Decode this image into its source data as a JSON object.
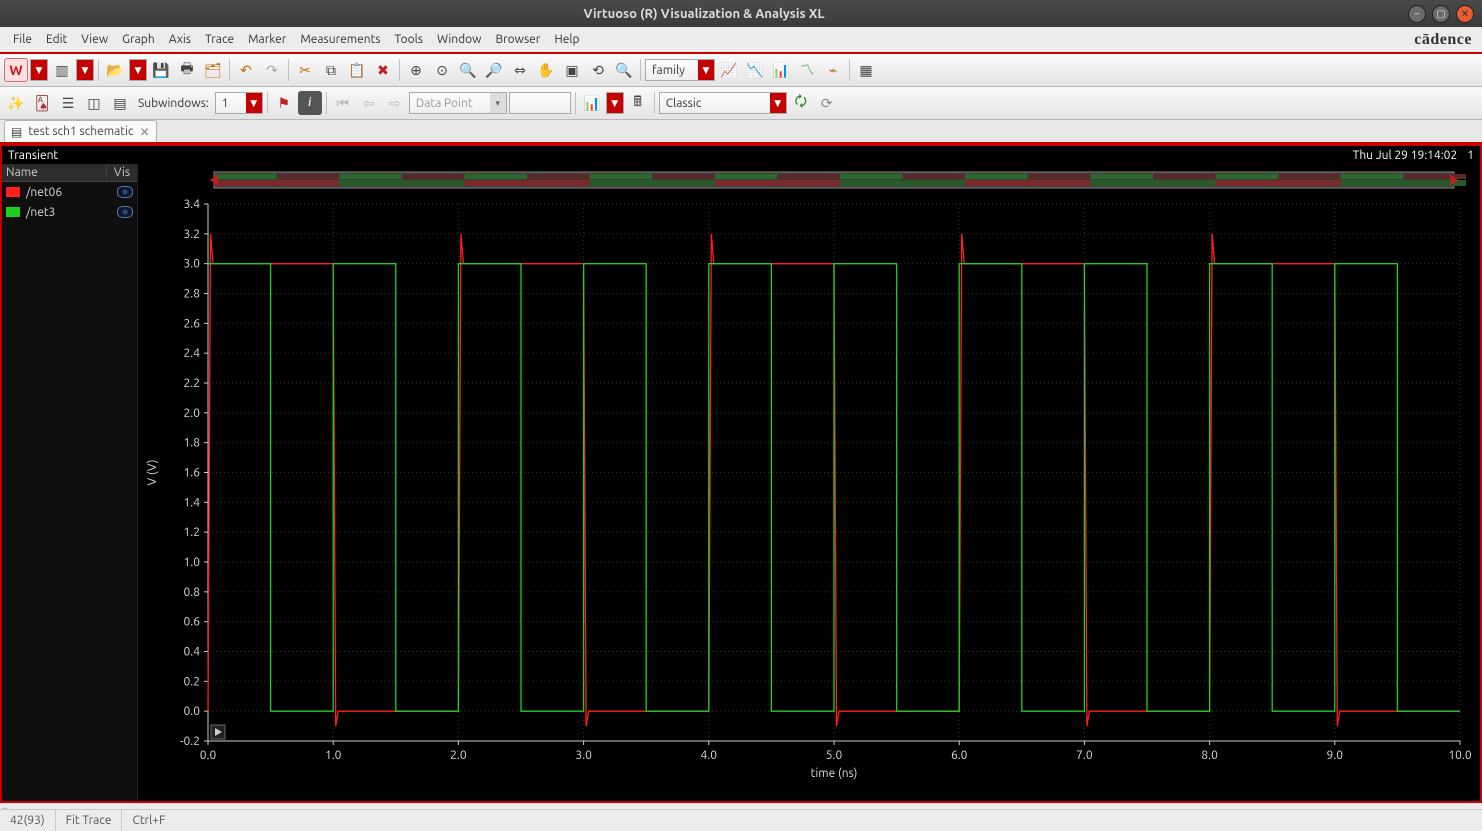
{
  "window": {
    "title": "Virtuoso (R) Visualization & Analysis XL"
  },
  "menu": [
    "File",
    "Edit",
    "View",
    "Graph",
    "Axis",
    "Trace",
    "Marker",
    "Measurements",
    "Tools",
    "Window",
    "Browser",
    "Help"
  ],
  "brand": "cādence",
  "toolbar1": {
    "combo_family": "family"
  },
  "toolbar2": {
    "subwindows_label": "Subwindows:",
    "subwindows_value": "1",
    "datapoint_label": "Data Point",
    "classic_label": "Classic"
  },
  "tab": {
    "label": "test sch1 schematic"
  },
  "plot": {
    "header": "Transient",
    "timestamp": "Thu Jul 29 19:14:02",
    "index": "1",
    "legend_cols": {
      "name": "Name",
      "vis": "Vis"
    },
    "xlabel": "time (ns)",
    "ylabel": "V (V)"
  },
  "legend": [
    {
      "name": "/net06",
      "color": "#ff2020"
    },
    {
      "name": "/net3",
      "color": "#20d020"
    }
  ],
  "status": {
    "left": "42(93)",
    "mid": "Fit Trace",
    "right": "Ctrl+F"
  },
  "chart_data": {
    "type": "line",
    "title": "Transient",
    "xlabel": "time (ns)",
    "ylabel": "V (V)",
    "xlim": [
      0.0,
      10.0
    ],
    "ylim": [
      -0.2,
      3.4
    ],
    "xticks": [
      0.0,
      1.0,
      2.0,
      3.0,
      4.0,
      5.0,
      6.0,
      7.0,
      8.0,
      9.0,
      10.0
    ],
    "yticks": [
      -0.2,
      0.0,
      0.2,
      0.4,
      0.6,
      0.8,
      1.0,
      1.2,
      1.4,
      1.6,
      1.8,
      2.0,
      2.2,
      2.4,
      2.6,
      2.8,
      3.0,
      3.2,
      3.4
    ],
    "net06_period_ns": 2.0,
    "net06_high_v": 3.0,
    "net06_low_v": 0.0,
    "net06_edges_ns": [
      0.0,
      1.0,
      2.0,
      3.0,
      4.0,
      5.0,
      6.0,
      7.0,
      8.0,
      9.0,
      10.0
    ],
    "net06_overshoot_v": 3.2,
    "net06_undershoot_v": -0.1,
    "net3_period_ns": 1.0,
    "net3_high_v": 3.0,
    "net3_low_v": 0.0,
    "net3_edges_ns": [
      0.0,
      0.5,
      1.0,
      1.5,
      2.0,
      2.5,
      3.0,
      3.5,
      4.0,
      4.5,
      5.0,
      5.5,
      6.0,
      6.5,
      7.0,
      7.5,
      8.0,
      8.5,
      9.0,
      9.5,
      10.0
    ],
    "series": [
      {
        "name": "/net06",
        "color": "#ff2020",
        "x": [
          0.0,
          0.02,
          0.04,
          1.0,
          1.02,
          1.04,
          2.0,
          2.02,
          2.04,
          3.0,
          3.02,
          3.04,
          4.0,
          4.02,
          4.04,
          5.0,
          5.02,
          5.04,
          6.0,
          6.02,
          6.04,
          7.0,
          7.02,
          7.04,
          8.0,
          8.02,
          8.04,
          9.0,
          9.02,
          9.04,
          10.0
        ],
        "y": [
          0.0,
          3.2,
          3.0,
          3.0,
          -0.1,
          0.0,
          0.0,
          3.2,
          3.0,
          3.0,
          -0.1,
          0.0,
          0.0,
          3.2,
          3.0,
          3.0,
          -0.1,
          0.0,
          0.0,
          3.2,
          3.0,
          3.0,
          -0.1,
          0.0,
          0.0,
          3.2,
          3.0,
          3.0,
          -0.1,
          0.0,
          0.0
        ]
      },
      {
        "name": "/net3",
        "color": "#20d020",
        "x": [
          0.0,
          0.5,
          0.5,
          1.0,
          1.0,
          1.5,
          1.5,
          2.0,
          2.0,
          2.5,
          2.5,
          3.0,
          3.0,
          3.5,
          3.5,
          4.0,
          4.0,
          4.5,
          4.5,
          5.0,
          5.0,
          5.5,
          5.5,
          6.0,
          6.0,
          6.5,
          6.5,
          7.0,
          7.0,
          7.5,
          7.5,
          8.0,
          8.0,
          8.5,
          8.5,
          9.0,
          9.0,
          9.5,
          9.5,
          10.0
        ],
        "y": [
          3.0,
          3.0,
          0.0,
          0.0,
          3.0,
          3.0,
          0.0,
          0.0,
          3.0,
          3.0,
          0.0,
          0.0,
          3.0,
          3.0,
          0.0,
          0.0,
          3.0,
          3.0,
          0.0,
          0.0,
          3.0,
          3.0,
          0.0,
          0.0,
          3.0,
          3.0,
          0.0,
          0.0,
          3.0,
          3.0,
          0.0,
          0.0,
          3.0,
          3.0,
          0.0,
          0.0,
          3.0,
          3.0,
          0.0,
          0.0
        ]
      }
    ]
  }
}
